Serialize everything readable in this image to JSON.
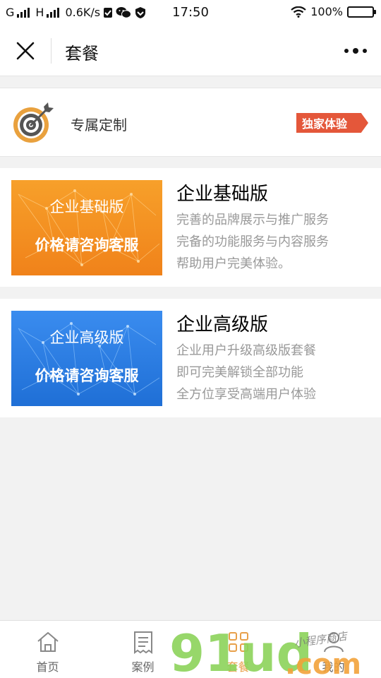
{
  "status_bar": {
    "carrier1": "G",
    "carrier2": "H",
    "speed": "0.6K/s",
    "time": "17:50",
    "battery": "100%",
    "battery_level": 1.0
  },
  "navbar": {
    "title": "套餐",
    "close_icon": "close-icon",
    "more_icon": "more-dots-icon"
  },
  "custom": {
    "icon": "target-icon",
    "label": "专属定制",
    "badge": "独家体验"
  },
  "packages": [
    {
      "title": "企业基础版",
      "banner_line1": "企业基础版",
      "banner_line2": "价格请咨询客服",
      "banner_color": "#f5921e",
      "desc": [
        "完善的品牌展示与推广服务",
        "完备的功能服务与内容服务",
        "帮助用户完美体验。"
      ]
    },
    {
      "title": "企业高级版",
      "banner_line1": "企业高级版",
      "banner_line2": "价格请咨询客服",
      "banner_color": "#2f7fe0",
      "desc": [
        "企业用户升级高级版套餐",
        "即可完美解锁全部功能",
        "全方位享受高端用户体验"
      ]
    }
  ],
  "tabs": [
    {
      "label": "首页",
      "icon": "home-icon",
      "active": false
    },
    {
      "label": "案例",
      "icon": "receipt-icon",
      "active": false
    },
    {
      "label": "套餐",
      "icon": "grid-icon",
      "active": true
    },
    {
      "label": "我的",
      "icon": "user-icon",
      "active": false
    }
  ],
  "watermark": {
    "logo": "91ud",
    "suffix": ".com",
    "script": "小程序商店"
  },
  "colors": {
    "accent": "#e8a04a",
    "badge": "#e4573a",
    "watermark_green": "#8cd35a",
    "watermark_orange": "#f2a23a"
  }
}
